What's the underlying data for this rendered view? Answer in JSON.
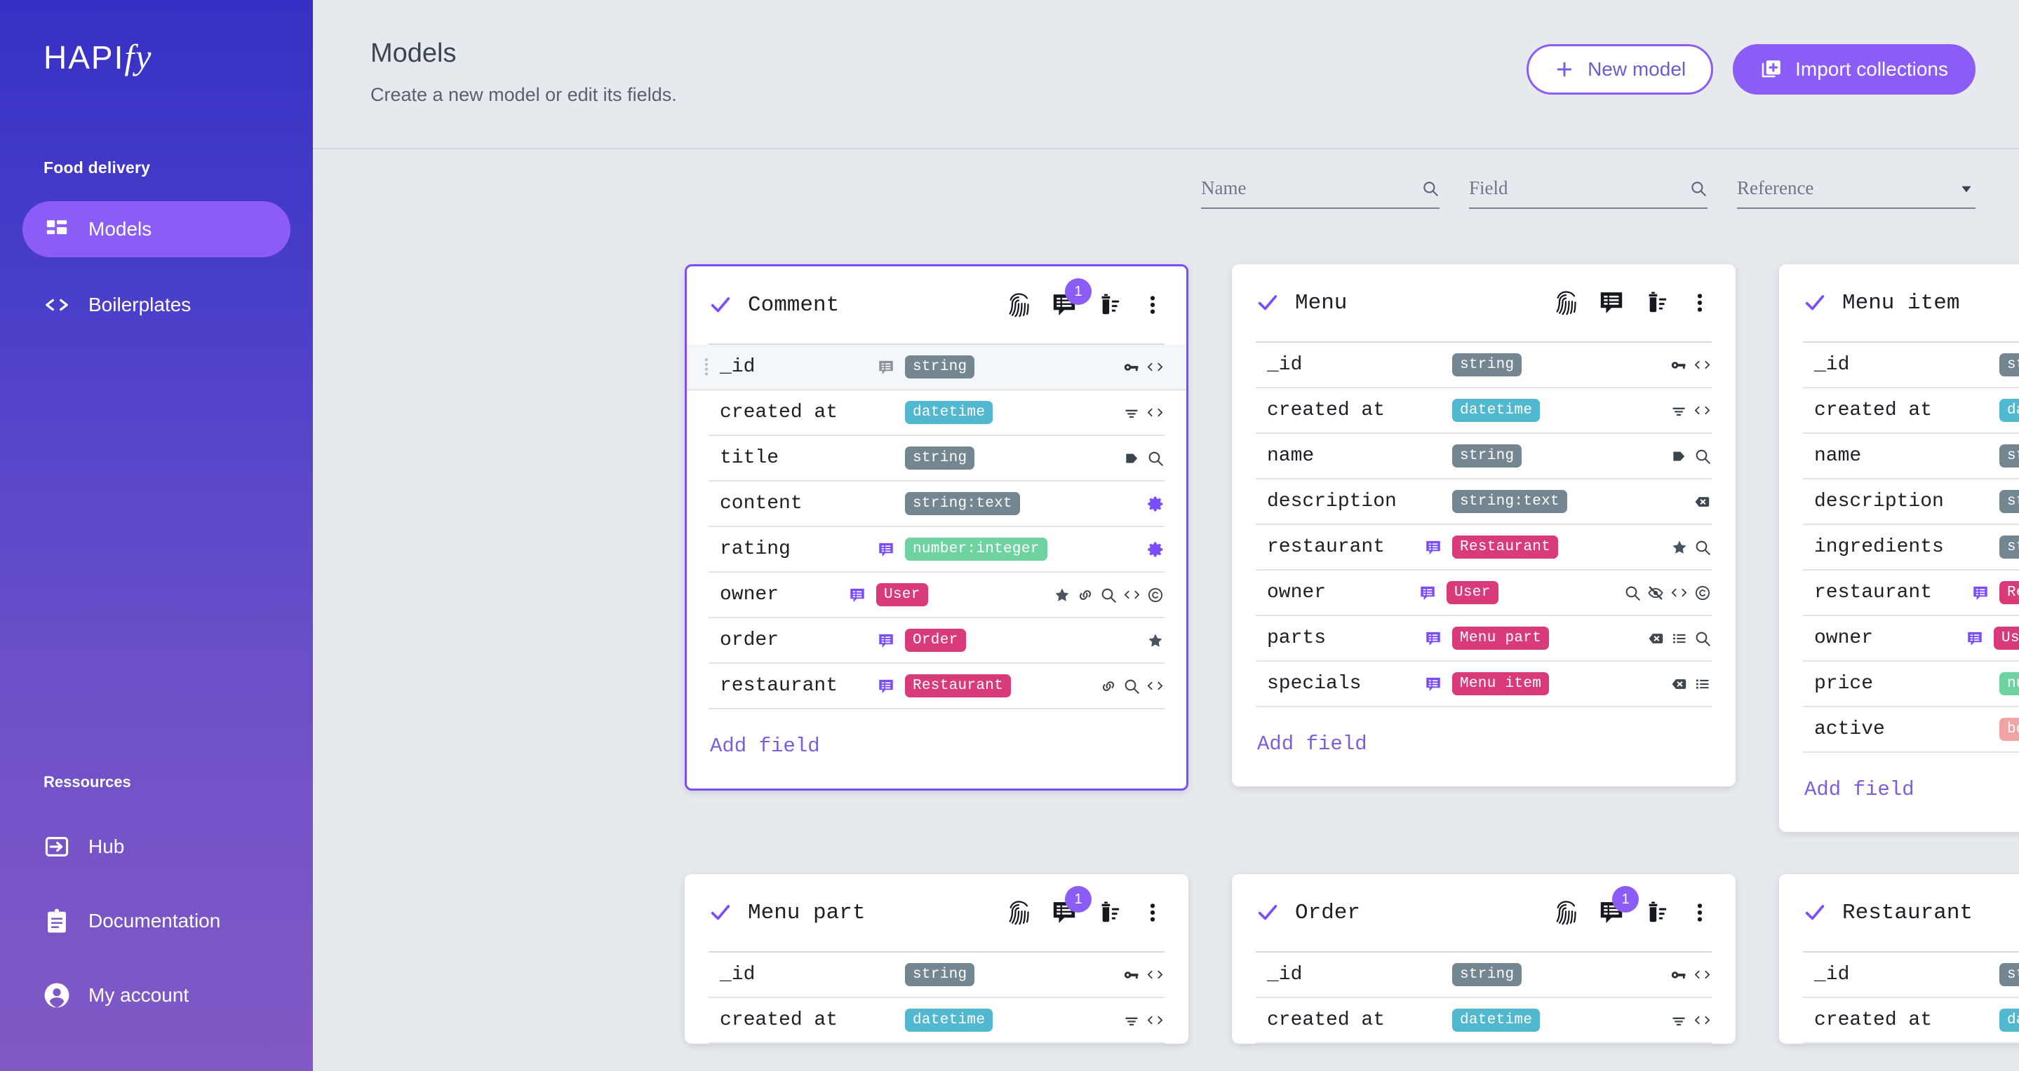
{
  "sidebar": {
    "logo_main": "HAPI",
    "logo_accent": "fy",
    "project": "Food delivery",
    "nav": [
      {
        "label": "Models",
        "icon": "dashboard-icon",
        "active": true
      },
      {
        "label": "Boilerplates",
        "icon": "code-brackets-icon",
        "active": false
      }
    ],
    "resources_heading": "Ressources",
    "resources": [
      {
        "label": "Hub",
        "icon": "hub-arrow-icon"
      },
      {
        "label": "Documentation",
        "icon": "clipboard-icon"
      },
      {
        "label": "My account",
        "icon": "account-circle-icon"
      }
    ]
  },
  "header": {
    "title": "Models",
    "subtitle": "Create a new model or edit its fields.",
    "new_model_label": "New model",
    "import_label": "Import collections"
  },
  "filters": [
    {
      "placeholder": "Name",
      "icon": "search-icon"
    },
    {
      "placeholder": "Field",
      "icon": "search-icon"
    },
    {
      "placeholder": "Reference",
      "icon": "chevron-down-icon"
    }
  ],
  "add_field_label": "Add field",
  "colors": {
    "accent": "#8b5cf6",
    "chip_string": "#74868f",
    "chip_datetime": "#52b8cf",
    "chip_number": "#6ed3a0",
    "chip_boolean": "#f2a3a3",
    "chip_ref": "#d93a78",
    "sidebar_top": "#3730c4",
    "sidebar_bottom": "#8259c6",
    "page_bg": "#e6e9ed"
  },
  "models": [
    {
      "name": "Comment",
      "selected": true,
      "badge": "1",
      "tools": [
        "fingerprint-icon",
        "comment-table-icon",
        "delete-sweep-icon",
        "more-vert-icon"
      ],
      "fields": [
        {
          "name": "_id",
          "type": "string",
          "chip": "string_gray",
          "note": true,
          "grip": true,
          "highlight": true,
          "icons": [
            "key-icon",
            "code-icon"
          ]
        },
        {
          "name": "created at",
          "type": "datetime",
          "chip": "datetime",
          "note": false,
          "icons": [
            "sort-icon",
            "code-icon"
          ]
        },
        {
          "name": "title",
          "type": "string",
          "chip": "string_gray",
          "note": false,
          "icons": [
            "tag-icon",
            "search-icon"
          ]
        },
        {
          "name": "content",
          "type": "string:text",
          "chip": "string_gray",
          "note": false,
          "icons": [
            "gear-icon"
          ]
        },
        {
          "name": "rating",
          "type": "number:integer",
          "chip": "number",
          "note": true,
          "icons": [
            "gear-icon"
          ]
        },
        {
          "name": "owner",
          "type": "User",
          "chip": "ref",
          "note": true,
          "icons": [
            "star-icon",
            "link-icon",
            "search-icon",
            "code-icon",
            "copyright-icon"
          ]
        },
        {
          "name": "order",
          "type": "Order",
          "chip": "ref",
          "note": true,
          "icons": [
            "star-icon"
          ]
        },
        {
          "name": "restaurant",
          "type": "Restaurant",
          "chip": "ref",
          "note": true,
          "icons": [
            "link-icon",
            "search-icon",
            "code-icon"
          ]
        }
      ]
    },
    {
      "name": "Menu",
      "selected": false,
      "badge": "",
      "tools": [
        "fingerprint-icon",
        "comment-table-icon",
        "delete-sweep-icon",
        "more-vert-icon"
      ],
      "fields": [
        {
          "name": "_id",
          "type": "string",
          "chip": "string_gray",
          "note": false,
          "icons": [
            "key-icon",
            "code-icon"
          ]
        },
        {
          "name": "created at",
          "type": "datetime",
          "chip": "datetime",
          "note": false,
          "icons": [
            "sort-icon",
            "code-icon"
          ]
        },
        {
          "name": "name",
          "type": "string",
          "chip": "string_gray",
          "note": false,
          "icons": [
            "tag-icon",
            "search-icon"
          ]
        },
        {
          "name": "description",
          "type": "string:text",
          "chip": "string_gray",
          "note": false,
          "icons": [
            "x-badge-icon"
          ]
        },
        {
          "name": "restaurant",
          "type": "Restaurant",
          "chip": "ref",
          "note": true,
          "icons": [
            "star-icon",
            "search-icon"
          ]
        },
        {
          "name": "owner",
          "type": "User",
          "chip": "ref",
          "note": true,
          "icons": [
            "search-icon",
            "eye-off-icon",
            "code-icon",
            "copyright-icon"
          ]
        },
        {
          "name": "parts",
          "type": "Menu part",
          "chip": "ref",
          "note": true,
          "icons": [
            "x-badge-icon",
            "list-icon",
            "search-icon"
          ]
        },
        {
          "name": "specials",
          "type": "Menu item",
          "chip": "ref",
          "note": true,
          "icons": [
            "x-badge-icon",
            "list-icon"
          ]
        }
      ]
    },
    {
      "name": "Menu item",
      "selected": false,
      "badge": "",
      "tools": [
        "fingerprint-icon",
        "comment-table-icon",
        "delete-sweep-icon",
        "more-vert-icon"
      ],
      "fields": [
        {
          "name": "_id",
          "type": "string",
          "chip": "string_gray",
          "note": false,
          "icons": [
            "key-icon",
            "code-icon"
          ]
        },
        {
          "name": "created at",
          "type": "datetime",
          "chip": "datetime",
          "note": false,
          "icons": [
            "sort-icon",
            "code-icon"
          ]
        },
        {
          "name": "name",
          "type": "string",
          "chip": "string_gray",
          "note": false,
          "icons": [
            "tag-icon",
            "search-icon"
          ]
        },
        {
          "name": "description",
          "type": "string:text",
          "chip": "string_gray",
          "note": false,
          "icons": [
            "x-badge-icon"
          ]
        },
        {
          "name": "ingredients",
          "type": "string:text",
          "chip": "string_gray",
          "note": false,
          "icons": [
            "x-badge-icon"
          ]
        },
        {
          "name": "restaurant",
          "type": "Restaurant",
          "chip": "ref",
          "note": true,
          "icons": [
            "search-icon"
          ]
        },
        {
          "name": "owner",
          "type": "User",
          "chip": "ref",
          "note": true,
          "icons": [
            "search-icon",
            "eye-off-icon",
            "code-icon",
            "copyright-icon"
          ]
        },
        {
          "name": "price",
          "type": "number:float",
          "chip": "number",
          "note": false,
          "icons": [
            "search-icon",
            "sort-icon"
          ]
        },
        {
          "name": "active",
          "type": "boolean",
          "chip": "boolean",
          "note": false,
          "icons": [
            "search-icon"
          ]
        }
      ]
    },
    {
      "name": "Menu part",
      "selected": false,
      "badge": "1",
      "tools": [
        "fingerprint-icon",
        "comment-table-icon",
        "delete-sweep-icon",
        "more-vert-icon"
      ],
      "fields": [
        {
          "name": "_id",
          "type": "string",
          "chip": "string_gray",
          "note": false,
          "icons": [
            "key-icon",
            "code-icon"
          ]
        },
        {
          "name": "created at",
          "type": "datetime",
          "chip": "datetime",
          "note": false,
          "icons": [
            "sort-icon",
            "code-icon"
          ]
        }
      ]
    },
    {
      "name": "Order",
      "selected": false,
      "badge": "1",
      "tools": [
        "fingerprint-icon",
        "comment-table-icon",
        "delete-sweep-icon",
        "more-vert-icon"
      ],
      "fields": [
        {
          "name": "_id",
          "type": "string",
          "chip": "string_gray",
          "note": false,
          "icons": [
            "key-icon",
            "code-icon"
          ]
        },
        {
          "name": "created at",
          "type": "datetime",
          "chip": "datetime",
          "note": false,
          "icons": [
            "sort-icon",
            "code-icon"
          ]
        }
      ]
    },
    {
      "name": "Restaurant",
      "selected": false,
      "badge": "",
      "tools": [
        "fingerprint-icon",
        "comment-table-icon",
        "delete-sweep-icon",
        "more-vert-icon"
      ],
      "fields": [
        {
          "name": "_id",
          "type": "string",
          "chip": "string_gray",
          "note": false,
          "icons": [
            "key-icon",
            "code-icon"
          ]
        },
        {
          "name": "created at",
          "type": "datetime",
          "chip": "datetime",
          "note": false,
          "icons": [
            "sort-icon",
            "code-icon"
          ]
        }
      ]
    }
  ]
}
